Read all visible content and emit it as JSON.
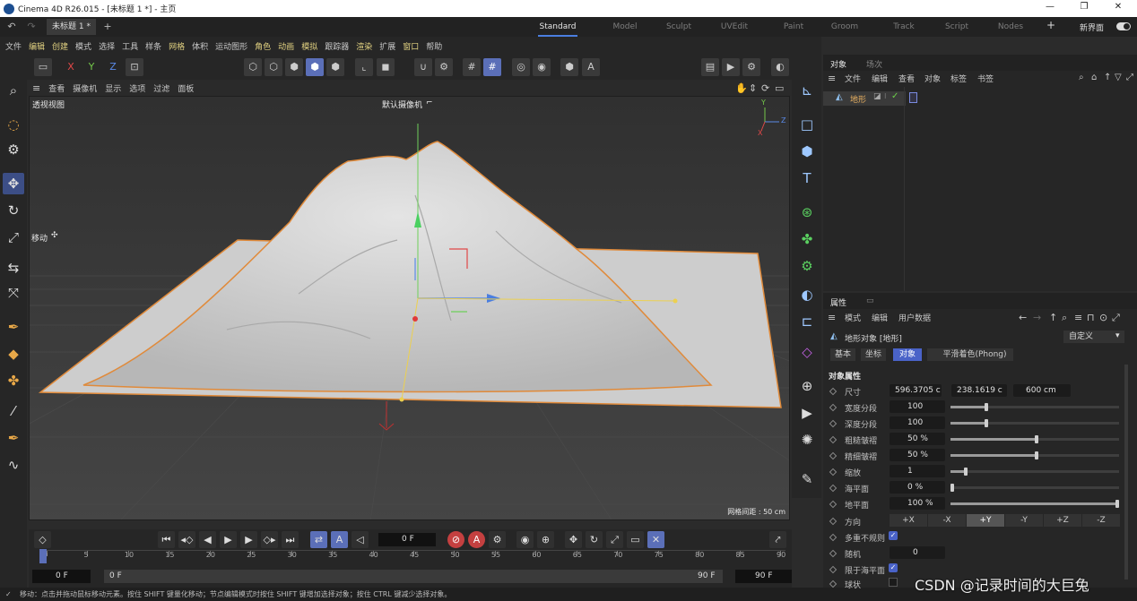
{
  "window": {
    "title": "Cinema 4D R26.015 - [未标题 1 *] - 主页"
  },
  "tabbar": {
    "doc_tab": "未标题 1 *",
    "add_tab": "+",
    "layouts": [
      "Standard",
      "Model",
      "Sculpt",
      "UVEdit",
      "Paint",
      "Groom",
      "Track",
      "Script",
      "Nodes"
    ],
    "active_layout": "Standard",
    "new_ui_label": "新界面"
  },
  "menubar": {
    "items": [
      "文件",
      "编辑",
      "创建",
      "模式",
      "选择",
      "工具",
      "样条",
      "网格",
      "体积",
      "运动图形",
      "角色",
      "动画",
      "模拟",
      "跟踪器",
      "渲染",
      "扩展",
      "窗口",
      "帮助"
    ]
  },
  "toolbar": {
    "axis_x": "X",
    "axis_y": "Y",
    "axis_z": "Z"
  },
  "viewport": {
    "menu": [
      "查看",
      "摄像机",
      "显示",
      "选项",
      "过滤",
      "面板"
    ],
    "view_name": "透视视图",
    "camera_name": "默认摄像机",
    "tool_hint": "移动",
    "grid_spacing": "网格间距 : 50 cm",
    "axis_gizmo_y": "Y",
    "axis_gizmo_z": "Z",
    "axis_gizmo_x": "X"
  },
  "timeline": {
    "current_frame": "0 F",
    "ticks": [
      "0",
      "5",
      "10",
      "15",
      "20",
      "25",
      "30",
      "35",
      "40",
      "45",
      "50",
      "55",
      "60",
      "65",
      "70",
      "75",
      "80",
      "85",
      "90"
    ],
    "start_frame": "0 F",
    "min_frame": "0 F",
    "max_frame": "90 F",
    "end_frame": "90 F"
  },
  "statusbar": {
    "text": "移动：点击并拖动鼠标移动元素。按住 SHIFT 键量化移动；节点编辑模式时按住 SHIFT 键增加选择对象；按住 CTRL 键减少选择对象。"
  },
  "objects_panel": {
    "tabs": [
      "对象",
      "场次"
    ],
    "menu": [
      "文件",
      "编辑",
      "查看",
      "对象",
      "标签",
      "书签"
    ],
    "items": [
      {
        "name": "地形"
      }
    ]
  },
  "attributes_panel": {
    "tabs": [
      "属性"
    ],
    "menu": [
      "模式",
      "编辑",
      "用户数据"
    ],
    "object_title": "地形对象 [地形]",
    "preset": "自定义",
    "subtabs": [
      "基本",
      "坐标",
      "对象"
    ],
    "active_subtab": "对象",
    "phong_tab": "平滑着色(Phong)",
    "section_title": "对象属性",
    "size_label": "尺寸",
    "size_values": [
      "596.3705 c",
      "238.1619 c",
      "600 cm"
    ],
    "params": [
      {
        "label": "宽度分段",
        "value": "100",
        "fraction": 0.2
      },
      {
        "label": "深度分段",
        "value": "100",
        "fraction": 0.2
      },
      {
        "label": "粗糙皱褶",
        "value": "50 %",
        "fraction": 0.5
      },
      {
        "label": "精细皱褶",
        "value": "50 %",
        "fraction": 0.5
      },
      {
        "label": "缩放",
        "value": "1",
        "fraction": 0.08
      },
      {
        "label": "海平面",
        "value": "0 %",
        "fraction": 0.0
      },
      {
        "label": "地平面",
        "value": "100 %",
        "fraction": 1.0
      }
    ],
    "direction_label": "方向",
    "directions": [
      "+X",
      "-X",
      "+Y",
      "-Y",
      "+Z",
      "-Z"
    ],
    "active_direction": "+Y",
    "multi_irregular_label": "多重不规则",
    "seed_label": "随机",
    "seed_value": "0",
    "limit_sea_label": "限于海平面",
    "sphere_label": "球状"
  },
  "watermark": "CSDN @记录时间的大巨兔",
  "colors": {
    "accent": "#4a7ee0",
    "selection_outline": "#e08a3a",
    "active_button": "#5b6fb8"
  }
}
